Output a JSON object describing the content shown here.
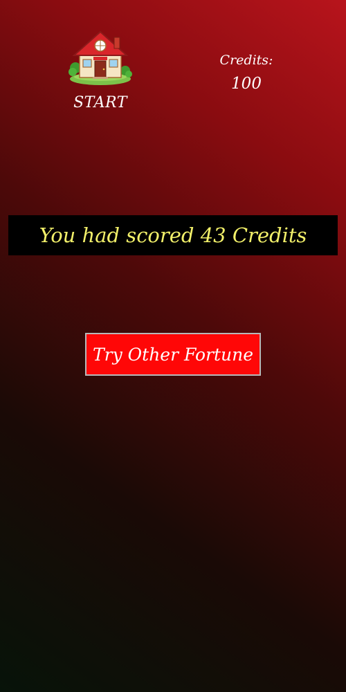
{
  "home": {
    "label": "START",
    "icon": "house-icon"
  },
  "credits": {
    "label": "Credits:",
    "value": "100"
  },
  "score_banner": {
    "text": "You had scored 43 Credits"
  },
  "try_button": {
    "label": "Try Other Fortune"
  },
  "colors": {
    "score_text": "#f2f06a",
    "button_bg": "#ff0707",
    "banner_bg": "#000000"
  }
}
